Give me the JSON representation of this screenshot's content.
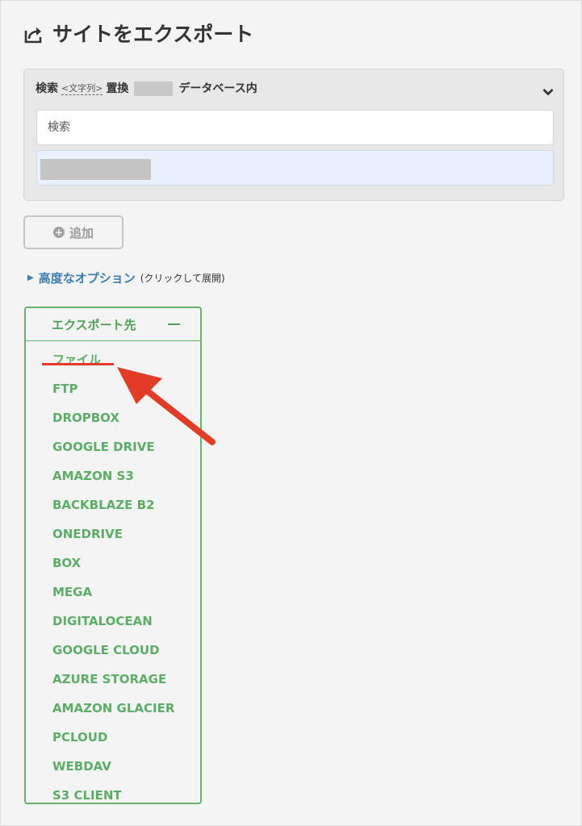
{
  "page": {
    "title": "サイトをエクスポート"
  },
  "search_replace": {
    "search_label": "検索",
    "hint": "<文字列>",
    "replace_label": "置換",
    "suffix": "データベース内",
    "search_placeholder": "検索",
    "replace_value": ""
  },
  "buttons": {
    "add_label": "追加"
  },
  "advanced": {
    "link": "高度なオプション",
    "note": "(クリックして展開)"
  },
  "export_destinations": {
    "header": "エクスポート先",
    "items": [
      "ファイル",
      "FTP",
      "DROPBOX",
      "GOOGLE DRIVE",
      "AMAZON S3",
      "BACKBLAZE B2",
      "ONEDRIVE",
      "BOX",
      "MEGA",
      "DIGITALOCEAN",
      "GOOGLE CLOUD",
      "AZURE STORAGE",
      "AMAZON GLACIER",
      "PCLOUD",
      "WEBDAV",
      "S3 CLIENT"
    ]
  },
  "colors": {
    "accent_green": "#5cad67",
    "link_blue": "#3b7fb0",
    "annotation_red": "#e23b26"
  }
}
